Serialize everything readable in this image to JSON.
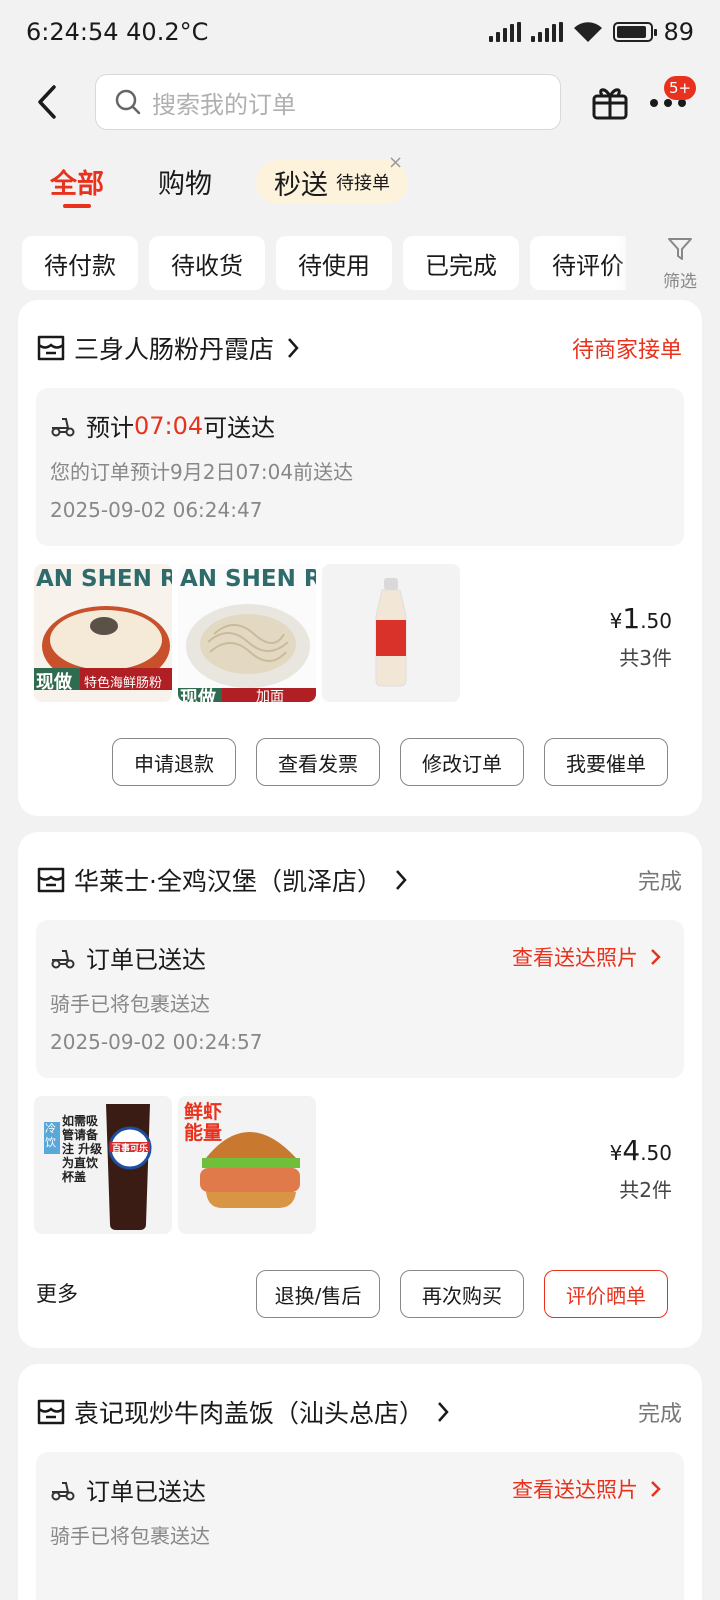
{
  "status_bar": {
    "time": "6:24:54 40.2°C",
    "battery": "89",
    "battery_level": 0.89
  },
  "header": {
    "search_placeholder": "搜索我的订单",
    "badge": "5+"
  },
  "tabs": {
    "all": "全部",
    "shopping": "购物",
    "flash": "秒送",
    "flash_sub": "待接单",
    "close": "×"
  },
  "filters": {
    "items": [
      "待付款",
      "待收货",
      "待使用",
      "已完成",
      "待评价"
    ],
    "filter_label": "筛选"
  },
  "orders": [
    {
      "shop": "三身人肠粉丹霞店",
      "status": "待商家接单",
      "eta_prefix": "预计",
      "eta_time": "07:04",
      "eta_suffix": "可送达",
      "line2": "您的订单预计9月2日07:04前送达",
      "line3": "2025-09-02 06:24:47",
      "price_symbol": "¥",
      "price_int": "1",
      "price_dec": ".50",
      "count": "共3件",
      "thumb1_banner": "AN SHEN RE",
      "thumb1_tag": "现做",
      "thumb1_caption": "特色海鲜肠粉",
      "thumb2_banner": "AN SHEN RE",
      "thumb2_tag": "现做",
      "thumb2_caption": "加面",
      "buttons": [
        "申请退款",
        "查看发票",
        "修改订单",
        "我要催单"
      ]
    },
    {
      "shop": "华莱士·全鸡汉堡（凯泽店）",
      "status": "完成",
      "line1": "订单已送达",
      "photo_link": "查看送达照片",
      "line2": "骑手已将包裹送达",
      "line3": "2025-09-02 00:24:57",
      "price_symbol": "¥",
      "price_int": "4",
      "price_dec": ".50",
      "count": "共2件",
      "thumb1_tag": "冷饮",
      "thumb1_text": "如需吸管请备注 升级为直饮杯盖",
      "thumb1_brand": "百事可乐",
      "thumb2_text": "鲜虾能量",
      "more": "更多",
      "buttons": [
        "退换/售后",
        "再次购买",
        "评价晒单"
      ]
    },
    {
      "shop": "袁记现炒牛肉盖饭（汕头总店）",
      "status": "完成",
      "line1": "订单已送达",
      "photo_link": "查看送达照片",
      "line2": "骑手已将包裹送达"
    }
  ]
}
